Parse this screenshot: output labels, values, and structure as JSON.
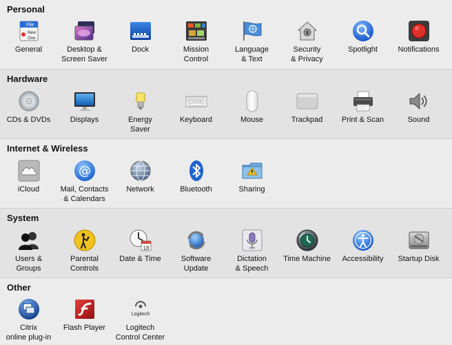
{
  "sections": [
    {
      "title": "Personal",
      "items": [
        {
          "label": "General",
          "icon": "general-icon"
        },
        {
          "label": "Desktop &\nScreen Saver",
          "icon": "desktop-icon"
        },
        {
          "label": "Dock",
          "icon": "dock-icon"
        },
        {
          "label": "Mission\nControl",
          "icon": "mission-control-icon"
        },
        {
          "label": "Language\n& Text",
          "icon": "flag-icon"
        },
        {
          "label": "Security\n& Privacy",
          "icon": "house-lock-icon"
        },
        {
          "label": "Spotlight",
          "icon": "magnifier-icon"
        },
        {
          "label": "Notifications",
          "icon": "notifications-icon"
        }
      ],
      "general_icon_text": [
        "File",
        "New",
        "One"
      ]
    },
    {
      "title": "Hardware",
      "items": [
        {
          "label": "CDs & DVDs",
          "icon": "disc-icon"
        },
        {
          "label": "Displays",
          "icon": "display-icon"
        },
        {
          "label": "Energy\nSaver",
          "icon": "bulb-icon"
        },
        {
          "label": "Keyboard",
          "icon": "keyboard-icon"
        },
        {
          "label": "Mouse",
          "icon": "mouse-icon"
        },
        {
          "label": "Trackpad",
          "icon": "trackpad-icon"
        },
        {
          "label": "Print & Scan",
          "icon": "printer-icon"
        },
        {
          "label": "Sound",
          "icon": "speaker-icon"
        }
      ]
    },
    {
      "title": "Internet & Wireless",
      "items": [
        {
          "label": "iCloud",
          "icon": "cloud-icon"
        },
        {
          "label": "Mail, Contacts\n& Calendars",
          "icon": "at-icon"
        },
        {
          "label": "Network",
          "icon": "globe-icon"
        },
        {
          "label": "Bluetooth",
          "icon": "bluetooth-icon"
        },
        {
          "label": "Sharing",
          "icon": "folder-icon"
        }
      ]
    },
    {
      "title": "System",
      "items": [
        {
          "label": "Users &\nGroups",
          "icon": "users-icon"
        },
        {
          "label": "Parental\nControls",
          "icon": "parental-icon"
        },
        {
          "label": "Date & Time",
          "icon": "clock-icon"
        },
        {
          "label": "Software\nUpdate",
          "icon": "update-icon"
        },
        {
          "label": "Dictation\n& Speech",
          "icon": "microphone-icon"
        },
        {
          "label": "Time Machine",
          "icon": "time-machine-icon"
        },
        {
          "label": "Accessibility",
          "icon": "accessibility-icon"
        },
        {
          "label": "Startup Disk",
          "icon": "hard-disk-icon"
        }
      ],
      "calendar_day": "18"
    },
    {
      "title": "Other",
      "items": [
        {
          "label": "Citrix\nonline plug-in",
          "icon": "citrix-icon"
        },
        {
          "label": "Flash Player",
          "icon": "flash-icon"
        },
        {
          "label": "Logitech\nControl Center",
          "icon": "logitech-icon"
        }
      ],
      "logitech_icon_text": "Logitech"
    }
  ],
  "colors": {
    "accent_blue": "#2b6fd6",
    "notifications_red": "#e0302a",
    "flash_red": "#c8201e"
  }
}
